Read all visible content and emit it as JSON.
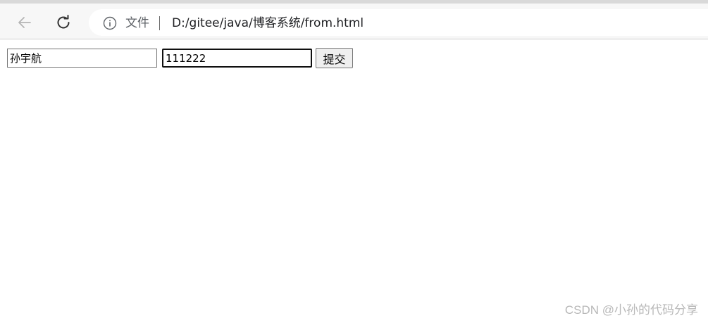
{
  "browser": {
    "file_label": "文件",
    "url": "D:/gitee/java/博客系统/from.html",
    "icons": {
      "back": "back-arrow-icon",
      "reload": "reload-icon",
      "info": "info-icon"
    }
  },
  "form": {
    "name_value": "孙宇航",
    "password_value": "111222",
    "submit_label": "提交"
  },
  "watermark": "CSDN @小孙的代码分享"
}
